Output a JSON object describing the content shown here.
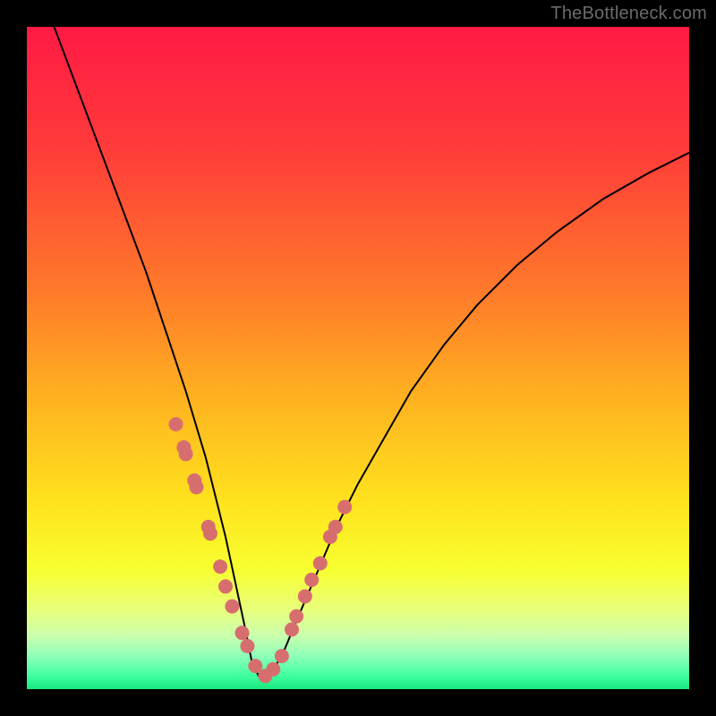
{
  "watermark": "TheBottleneck.com",
  "colors": {
    "page_bg": "#000000",
    "watermark": "#6b6b6b",
    "curve": "#000000",
    "marker_fill": "#d76e6e",
    "marker_stroke": "#d76e6e",
    "gradient_stops": [
      {
        "offset": 0,
        "color": "#ff1a44"
      },
      {
        "offset": 18,
        "color": "#ff3a3a"
      },
      {
        "offset": 40,
        "color": "#ff7a2a"
      },
      {
        "offset": 58,
        "color": "#ffb81f"
      },
      {
        "offset": 72,
        "color": "#ffe31e"
      },
      {
        "offset": 82,
        "color": "#f7ff30"
      },
      {
        "offset": 88,
        "color": "#e8ff7c"
      },
      {
        "offset": 92,
        "color": "#c9ffae"
      },
      {
        "offset": 95,
        "color": "#8fffb9"
      },
      {
        "offset": 98,
        "color": "#3fffa0"
      },
      {
        "offset": 100,
        "color": "#17e87d"
      }
    ]
  },
  "chart_data": {
    "type": "line",
    "title": "",
    "xlabel": "",
    "ylabel": "",
    "xlim": [
      0,
      100
    ],
    "ylim": [
      0,
      100
    ],
    "series": [
      {
        "name": "bottleneck-v-curve",
        "x": [
          0,
          3,
          6,
          9,
          12,
          15,
          18,
          21,
          24,
          27,
          28.5,
          30,
          31.5,
          33,
          34,
          35,
          36.5,
          38.5,
          41,
          44,
          47,
          50,
          54,
          58,
          63,
          68,
          74,
          80,
          87,
          94,
          100
        ],
        "values": [
          110,
          103,
          95,
          87,
          79,
          71,
          63,
          54,
          45,
          35,
          29,
          23,
          16,
          9,
          4,
          2,
          2,
          5,
          11,
          18,
          25,
          31,
          38,
          45,
          52,
          58,
          64,
          69,
          74,
          78,
          81
        ]
      }
    ],
    "markers": {
      "name": "highlighted-points",
      "x": [
        22.5,
        23.7,
        24.0,
        25.3,
        25.6,
        27.4,
        27.7,
        29.2,
        30.0,
        31.0,
        32.5,
        33.3,
        34.5,
        36.0,
        37.2,
        38.5,
        40.0,
        40.7,
        42.0,
        43.0,
        44.3,
        45.8,
        46.6,
        48.0
      ],
      "values": [
        40.0,
        36.5,
        35.5,
        31.5,
        30.5,
        24.5,
        23.5,
        18.5,
        15.5,
        12.5,
        8.5,
        6.5,
        3.5,
        2.0,
        3.0,
        5.0,
        9.0,
        11.0,
        14.0,
        16.5,
        19.0,
        23.0,
        24.5,
        27.5
      ]
    },
    "annotations": []
  }
}
